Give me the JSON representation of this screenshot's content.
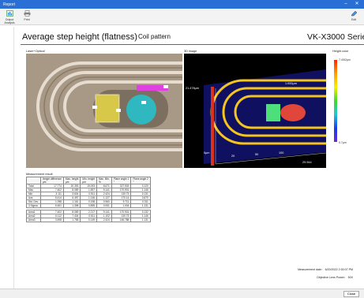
{
  "window": {
    "title": "Report",
    "minimize_glyph": "–",
    "close_glyph": "✕"
  },
  "toolbar": {
    "btn1_label": "Output Analysis",
    "btn2_label": "Print",
    "btn1_icon": "report-icon",
    "btn2_icon": "print-icon",
    "right_icon": "edit-icon",
    "right_label": "Edit"
  },
  "report": {
    "title": "Average step height (flatness)",
    "subtitle": "Coil pattern",
    "model": "VK-X3000 Series",
    "optical_label": "Laser+Optical",
    "image3d_label": "3D image",
    "height_label": "Height color",
    "colorbar_max": "7.40ℓ2µm",
    "colorbar_min": "0.7µm",
    "table_caption": "Measurement result",
    "date_line": "Measurement date：  6/20/2022 2:30:07 PM",
    "lens_line": "Objective Lens Power：  50X"
  },
  "table": {
    "headers": [
      "",
      "Height difference\nµm",
      "Max. height\nµm",
      "Min. height\nµm",
      "Max. Min.\n%",
      "Plane angle 1\n°",
      "Plane angle 2\n°"
    ],
    "rows": [
      [
        "Total",
        "17.774",
        "20.393",
        "19.093",
        "8.671",
        "327.903",
        "0.120"
      ],
      [
        "Max.",
        "7.402",
        "8.089",
        "1.557",
        "9.141",
        "170.901",
        "1.146"
      ],
      [
        "Min.",
        "3.111",
        "3.604",
        "0.511",
        "2.424",
        "130.73",
        "0.131"
      ],
      [
        "Ave.",
        "5.414",
        "6.497",
        "1.146",
        "1.127",
        "170.14",
        "0.670"
      ],
      [
        "Std. Dev.",
        "1.098",
        "1.161",
        "0.198",
        "0.960",
        "9.711",
        "0.311"
      ],
      [
        "3 Sigma",
        "5.451",
        "1.398",
        "0.895",
        "0.931",
        "1.004",
        "1.131"
      ]
    ],
    "rows2": [
      [
        "Area1",
        "7.402",
        "8.089",
        "2.217",
        "9.141",
        "170.901",
        "0.132"
      ],
      [
        "Area2",
        "6.112",
        "7.404",
        "0.511",
        "1.102",
        "130.73",
        "1.146"
      ],
      [
        "Area3",
        "3.498",
        "1.758",
        "0.149",
        "2.424",
        "146.788",
        "1.131"
      ]
    ]
  },
  "axis3d": {
    "left": "21.478µm",
    "right": "1.000µm",
    "origin": "0µm",
    "ticks": [
      "20",
      "50",
      "100",
      "20"
    ],
    "end": "29.944"
  },
  "statusbar": {
    "close_label": "Close"
  }
}
